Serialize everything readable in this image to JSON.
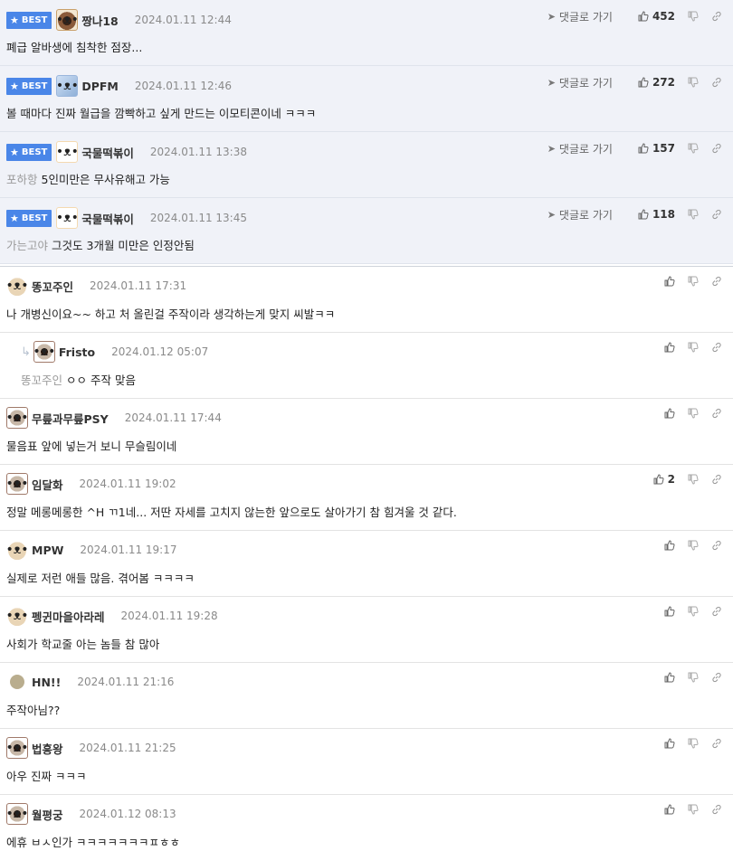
{
  "best_badge": "BEST",
  "goto_label": "댓글로 가기",
  "best": [
    {
      "nick": "짱나18",
      "date": "2024.01.11 12:44",
      "text": "폐급 알바생에 침착한 점장...",
      "mention": "",
      "likes": "452",
      "avatar": "bear-icon"
    },
    {
      "nick": "DPFM",
      "date": "2024.01.11 12:46",
      "text": "볼 때마다 진짜 월급을 깜빡하고 싶게 만드는 이모티콘이네 ㅋㅋㅋ",
      "mention": "",
      "likes": "272",
      "avatar": "frost-icon"
    },
    {
      "nick": "국물떡볶이",
      "date": "2024.01.11 13:38",
      "text": "5인미만은 무사유해고 가능",
      "mention": "포하항",
      "likes": "157",
      "avatar": "shiba-icon"
    },
    {
      "nick": "국물떡볶이",
      "date": "2024.01.11 13:45",
      "text": "그것도 3개월 미만은 인정안됨",
      "mention": "가는고야",
      "likes": "118",
      "avatar": "shiba-icon"
    }
  ],
  "comments": [
    {
      "nick": "똥꼬주인",
      "date": "2024.01.11 17:31",
      "text": "나 개병신이요~~ 하고 처 올린걸 주작이라 생각하는게 맞지 씨발ㅋㅋ",
      "mention": "",
      "likes": "",
      "reply": false,
      "avatar": "puppy-icon"
    },
    {
      "nick": "Fristo",
      "date": "2024.01.12 05:07",
      "text": "ㅇㅇ 주작 맞음",
      "mention": "똥꼬주인",
      "likes": "",
      "reply": true,
      "avatar": "dog-icon"
    },
    {
      "nick": "무릎과무릎PSY",
      "date": "2024.01.11 17:44",
      "text": "물음표 앞에 넣는거 보니 무슬림이네",
      "mention": "",
      "likes": "",
      "reply": false,
      "avatar": "dog-icon"
    },
    {
      "nick": "임달화",
      "date": "2024.01.11 19:02",
      "text": "정말 메롱메롱한 ^H ㄲ1네... 저딴 자세를 고치지 않는한 앞으로도 살아가기 참 힘겨울 것 같다.",
      "mention": "",
      "likes": "2",
      "reply": false,
      "avatar": "dog-icon"
    },
    {
      "nick": "MPW",
      "date": "2024.01.11 19:17",
      "text": "실제로 저런 애들 많음. 겪어봄 ㅋㅋㅋㅋ",
      "mention": "",
      "likes": "",
      "reply": false,
      "avatar": "puppy-icon"
    },
    {
      "nick": "펭귄마을아라레",
      "date": "2024.01.11 19:28",
      "text": "사회가 학교줄 아는 놈들 참 많아",
      "mention": "",
      "likes": "",
      "reply": false,
      "avatar": "puppy-icon"
    },
    {
      "nick": "HN!!",
      "date": "2024.01.11 21:16",
      "text": "주작아님??",
      "mention": "",
      "likes": "",
      "reply": false,
      "avatar": "dot-icon"
    },
    {
      "nick": "법흥왕",
      "date": "2024.01.11 21:25",
      "text": "아우 진짜 ㅋㅋㅋ",
      "mention": "",
      "likes": "",
      "reply": false,
      "avatar": "dog-icon"
    },
    {
      "nick": "월평궁",
      "date": "2024.01.12 08:13",
      "text": "에휴 ㅂㅅ인가 ㅋㅋㅋㅋㅋㅋㅋㅍㅎㅎ",
      "mention": "",
      "likes": "",
      "reply": false,
      "avatar": "dog-icon"
    }
  ]
}
